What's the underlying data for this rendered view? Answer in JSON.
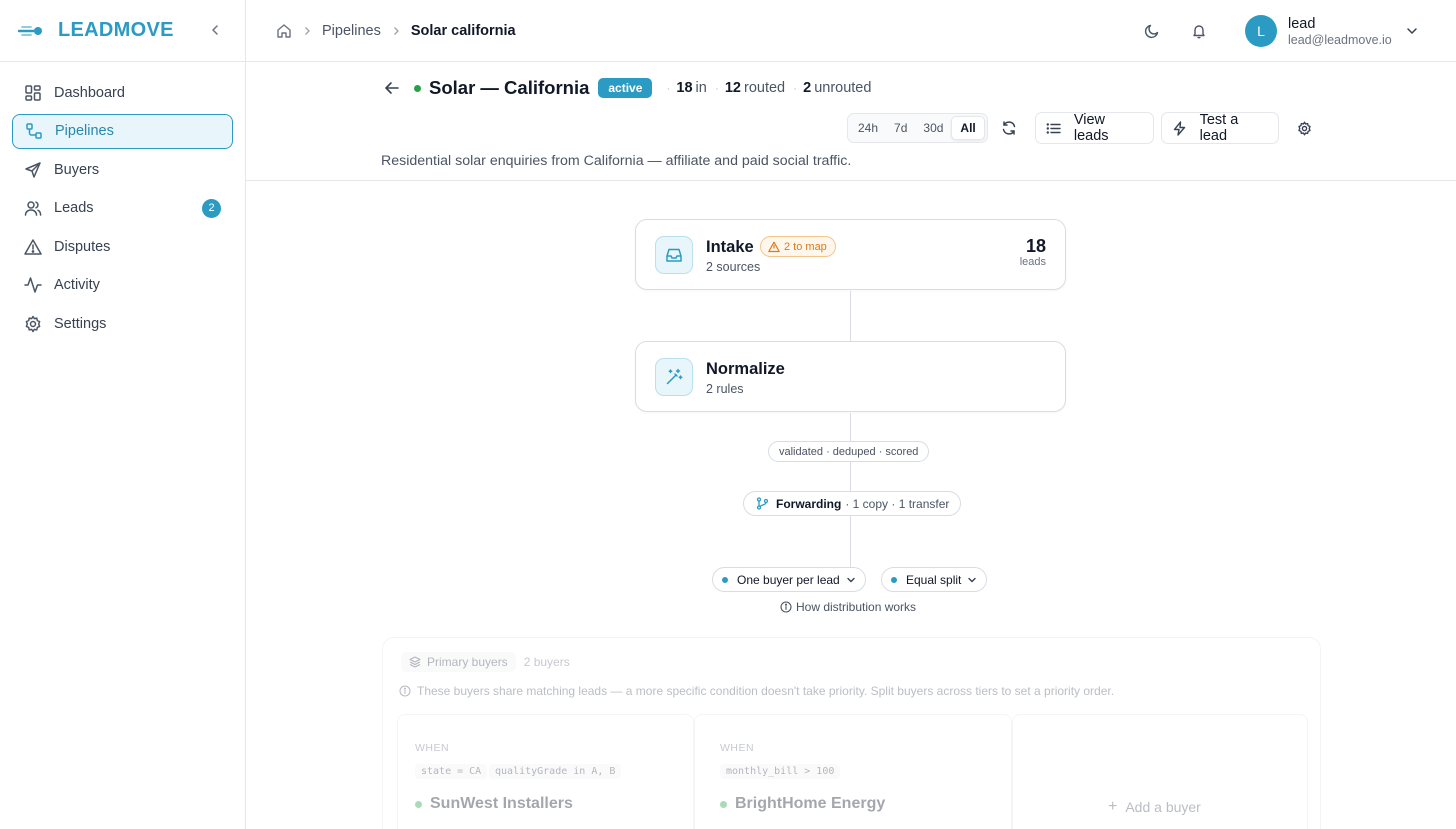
{
  "brand": {
    "name": "LEADMOVE"
  },
  "sidebar": {
    "items": [
      {
        "label": "Dashboard",
        "icon": "dashboard-icon"
      },
      {
        "label": "Pipelines",
        "icon": "pipelines-icon",
        "active": true
      },
      {
        "label": "Buyers",
        "icon": "send-icon"
      },
      {
        "label": "Leads",
        "icon": "users-icon",
        "badge": "2"
      },
      {
        "label": "Disputes",
        "icon": "alert-triangle-icon"
      },
      {
        "label": "Activity",
        "icon": "activity-icon"
      },
      {
        "label": "Settings",
        "icon": "gear-icon"
      }
    ]
  },
  "breadcrumb": {
    "section": "Pipelines",
    "current": "Solar california"
  },
  "user": {
    "initial": "L",
    "name": "lead",
    "email": "lead@leadmove.io"
  },
  "pipeline": {
    "title": "Solar — California",
    "status": "active",
    "stats": {
      "in_value": "18",
      "in_label": "in",
      "routed_value": "12",
      "routed_label": "routed",
      "unrouted_value": "2",
      "unrouted_label": "unrouted"
    },
    "description": "Residential solar enquiries from California — affiliate and paid social traffic.",
    "ranges": [
      "24h",
      "7d",
      "30d",
      "All"
    ],
    "selected_range": "All",
    "view_leads_label": "View leads",
    "test_lead_label": "Test a lead"
  },
  "flow": {
    "intake": {
      "title": "Intake",
      "warning": "2 to map",
      "subtitle": "2 sources",
      "count": "18",
      "count_label": "leads"
    },
    "normalize": {
      "title": "Normalize",
      "subtitle": "2 rules"
    },
    "stage_chip": "validated · deduped · scored",
    "forwarding": {
      "label": "Forwarding",
      "detail": "· 1 copy · 1 transfer"
    },
    "distribution_mode": "One buyer per lead",
    "split_mode": "Equal split",
    "how_link": "How distribution works"
  },
  "buyers_panel": {
    "tag": "Primary buyers",
    "count": "2 buyers",
    "note": "These buyers share matching leads — a more specific condition doesn't take priority. Split buyers across tiers to set a priority order.",
    "when_label": "WHEN",
    "buyers": [
      {
        "name": "SunWest Installers",
        "conditions": [
          "state = CA",
          "qualityGrade in A, B"
        ]
      },
      {
        "name": "BrightHome Energy",
        "conditions": [
          "monthly_bill > 100"
        ]
      }
    ],
    "add_label": "Add a buyer"
  },
  "colors": {
    "accent": "#2b9bc4",
    "success": "#22a34a",
    "warning": "#dd7a1a"
  }
}
